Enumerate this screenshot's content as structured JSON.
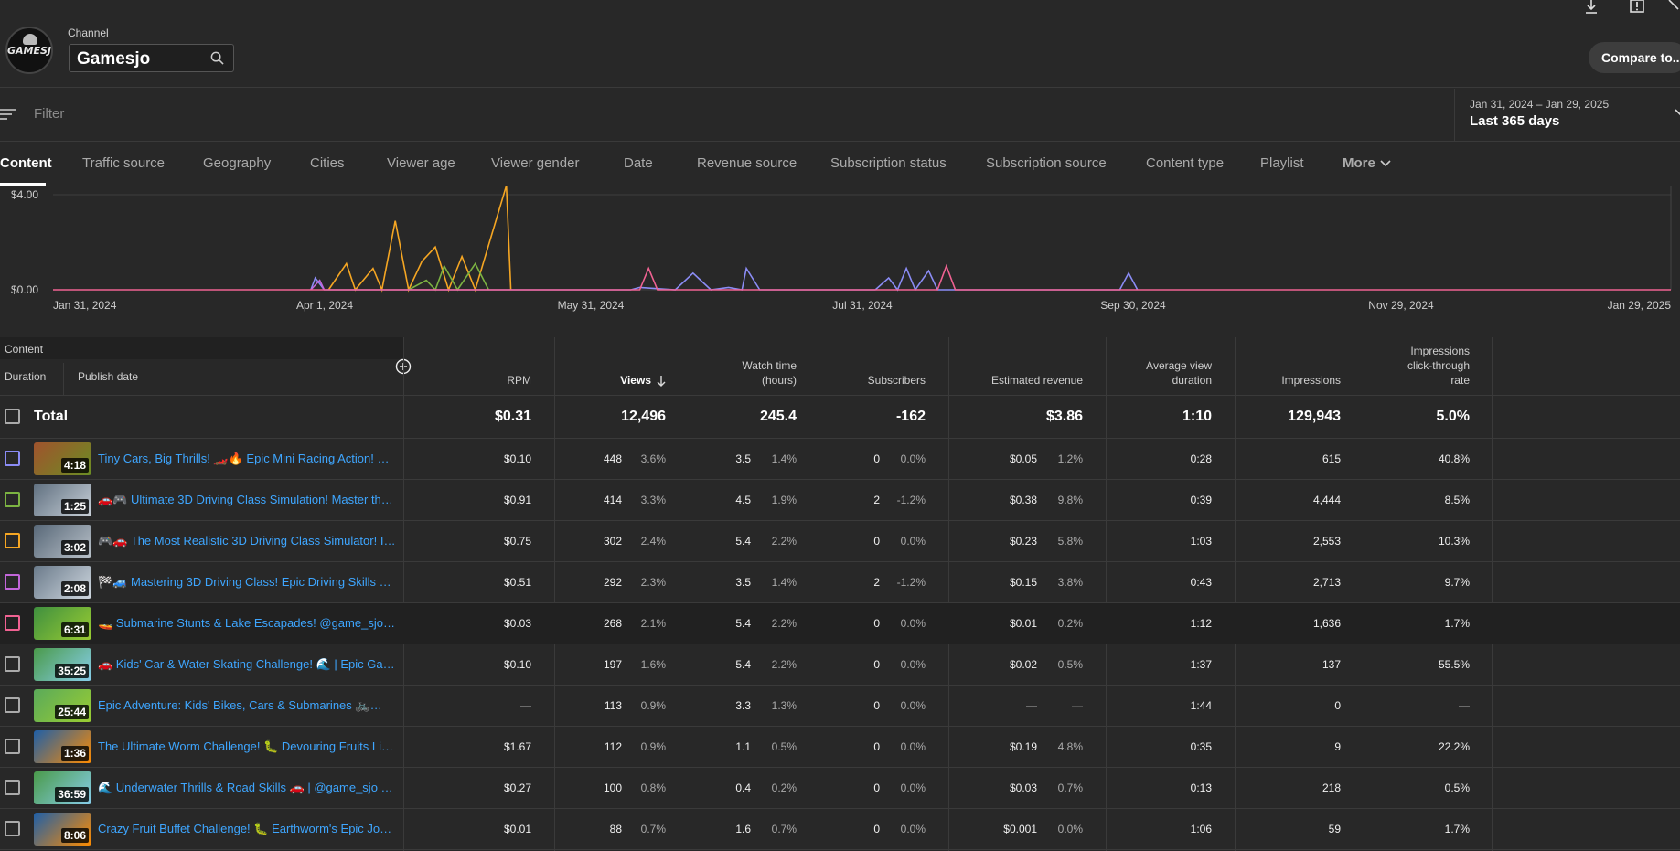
{
  "header": {
    "channel_label": "Channel",
    "channel_value": "Gamesjo",
    "avatar_text": "GAMESJO",
    "compare_button": "Compare to..."
  },
  "filter": {
    "placeholder": "Filter",
    "date_range": "Jan 31, 2024 – Jan 29, 2025",
    "date_preset": "Last 365 days"
  },
  "tabs": [
    {
      "label": "Content",
      "active": true
    },
    {
      "label": "Traffic source"
    },
    {
      "label": "Geography"
    },
    {
      "label": "Cities"
    },
    {
      "label": "Viewer age"
    },
    {
      "label": "Viewer gender"
    },
    {
      "label": "Date"
    },
    {
      "label": "Revenue source"
    },
    {
      "label": "Subscription status"
    },
    {
      "label": "Subscription source"
    },
    {
      "label": "Content type"
    },
    {
      "label": "Playlist"
    },
    {
      "label": "More"
    }
  ],
  "chart_data": {
    "type": "line",
    "y_ticks": [
      "$4.00",
      "$0.00"
    ],
    "x_ticks": [
      "Jan 31, 2024",
      "Apr 1, 2024",
      "May 31, 2024",
      "Jul 31, 2024",
      "Sep 30, 2024",
      "Nov 29, 2024",
      "Jan 29, 2025"
    ],
    "ylim": [
      0,
      4
    ],
    "series": [
      {
        "color": "#f5a623",
        "points": [
          [
            62,
            0
          ],
          [
            66,
            1.1
          ],
          [
            68,
            0
          ],
          [
            72,
            0.9
          ],
          [
            74,
            0
          ],
          [
            77,
            2.9
          ],
          [
            80,
            0
          ],
          [
            83,
            1.2
          ],
          [
            86,
            1.8
          ],
          [
            89,
            0
          ],
          [
            92,
            1.4
          ],
          [
            95,
            0
          ],
          [
            102,
            4.4
          ],
          [
            103,
            0
          ]
        ]
      },
      {
        "color": "#7cb342",
        "points": [
          [
            80,
            0
          ],
          [
            84,
            0.4
          ],
          [
            86,
            0
          ],
          [
            88,
            1.0
          ],
          [
            91,
            0
          ],
          [
            95,
            1.1
          ],
          [
            98,
            0
          ]
        ]
      },
      {
        "color": "#8b8cf5",
        "points": [
          [
            58,
            0
          ],
          [
            59,
            0.5
          ],
          [
            61,
            0
          ],
          [
            130,
            0
          ],
          [
            132,
            0.1
          ],
          [
            140,
            0
          ],
          [
            144,
            0.7
          ],
          [
            148,
            0
          ],
          [
            152,
            0.1
          ],
          [
            155,
            0
          ],
          [
            156,
            0.9
          ],
          [
            159,
            0
          ],
          [
            185,
            0
          ],
          [
            188,
            0.5
          ],
          [
            190,
            0
          ],
          [
            192,
            0.9
          ],
          [
            194,
            0
          ],
          [
            197,
            0.8
          ],
          [
            199,
            0
          ],
          [
            240,
            0
          ],
          [
            242,
            0.7
          ],
          [
            244,
            0
          ]
        ]
      },
      {
        "color": "#c266d9",
        "points": [
          [
            58,
            0
          ],
          [
            60,
            0.4
          ],
          [
            61,
            0
          ]
        ]
      },
      {
        "color": "#f06292",
        "points": [
          [
            0,
            0
          ],
          [
            132,
            0
          ],
          [
            134,
            0.9
          ],
          [
            136,
            0
          ],
          [
            199,
            0
          ],
          [
            201,
            1.0
          ],
          [
            203,
            0
          ],
          [
            364,
            0
          ]
        ]
      }
    ]
  },
  "table": {
    "content_header": "Content",
    "duration_header": "Duration",
    "publish_header": "Publish date",
    "columns": [
      {
        "label": "RPM"
      },
      {
        "label": "Views",
        "sorted": true
      },
      {
        "label": "Watch time\n(hours)"
      },
      {
        "label": "Subscribers"
      },
      {
        "label": "Estimated revenue"
      },
      {
        "label": "Average view\nduration"
      },
      {
        "label": "Impressions"
      },
      {
        "label": "Impressions\nclick-through\nrate"
      }
    ],
    "total": {
      "label": "Total",
      "rpm": "$0.31",
      "views": "12,496",
      "watch": "245.4",
      "subs": "-162",
      "revenue": "$3.86",
      "avd": "1:10",
      "impr": "129,943",
      "ctr": "5.0%"
    },
    "rows": [
      {
        "color": "#8b8cf5",
        "duration": "4:18",
        "title": "Tiny Cars, Big Thrills! 🏎️🔥 Epic Mini Racing Action! @game_sjo",
        "rpm": "$0.10",
        "views": "448",
        "views_pct": "3.6%",
        "watch": "3.5",
        "watch_pct": "1.4%",
        "subs": "0",
        "subs_pct": "0.0%",
        "rev": "$0.05",
        "rev_pct": "1.2%",
        "avd": "0:28",
        "impr": "615",
        "ctr": "40.8%",
        "thumb": [
          "#a0522d",
          "#6b8e23"
        ]
      },
      {
        "color": "#7cb342",
        "duration": "1:25",
        "title": "🚗🎮 Ultimate 3D Driving Class Simulation! Master the Roads",
        "rpm": "$0.91",
        "views": "414",
        "views_pct": "3.3%",
        "watch": "4.5",
        "watch_pct": "1.9%",
        "subs": "2",
        "subs_pct": "-1.2%",
        "rev": "$0.38",
        "rev_pct": "9.8%",
        "avd": "0:39",
        "impr": "4,444",
        "ctr": "8.5%",
        "thumb": [
          "#607080",
          "#c8d0d8"
        ]
      },
      {
        "color": "#f5a623",
        "duration": "3:02",
        "title": "🎮🚗 The Most Realistic 3D Driving Class Simulator! Incredible",
        "rpm": "$0.75",
        "views": "302",
        "views_pct": "2.4%",
        "watch": "5.4",
        "watch_pct": "2.2%",
        "subs": "0",
        "subs_pct": "0.0%",
        "rev": "$0.23",
        "rev_pct": "5.8%",
        "avd": "1:03",
        "impr": "2,553",
        "ctr": "10.3%",
        "thumb": [
          "#586878",
          "#b8c0c8"
        ]
      },
      {
        "color": "#c266d9",
        "duration": "2:08",
        "title": "🏁🚙 Mastering 3D Driving Class! Epic Driving Skills & Challenges",
        "rpm": "$0.51",
        "views": "292",
        "views_pct": "2.3%",
        "watch": "3.5",
        "watch_pct": "1.4%",
        "subs": "2",
        "subs_pct": "-1.2%",
        "rev": "$0.15",
        "rev_pct": "3.8%",
        "avd": "0:43",
        "impr": "2,713",
        "ctr": "9.7%",
        "thumb": [
          "#6a7a8a",
          "#d0d8e0"
        ]
      },
      {
        "color": "#f06292",
        "duration": "6:31",
        "title": "🚤 Submarine Stunts & Lake Escapades! @game_sjo #gaming",
        "rpm": "$0.03",
        "views": "268",
        "views_pct": "2.1%",
        "watch": "5.4",
        "watch_pct": "2.2%",
        "subs": "0",
        "subs_pct": "0.0%",
        "rev": "$0.01",
        "rev_pct": "0.2%",
        "avd": "1:12",
        "impr": "1,636",
        "ctr": "1.7%",
        "thumb": [
          "#3f8f3f",
          "#9acd32"
        ]
      },
      {
        "color": "#aaaaaa",
        "duration": "35:25",
        "title": "🚗 Kids' Car & Water Skating Challenge! 🌊 | Epic Gameplay",
        "rpm": "$0.10",
        "views": "197",
        "views_pct": "1.6%",
        "watch": "5.4",
        "watch_pct": "2.2%",
        "subs": "0",
        "subs_pct": "0.0%",
        "rev": "$0.02",
        "rev_pct": "0.5%",
        "avd": "1:37",
        "impr": "137",
        "ctr": "55.5%",
        "thumb": [
          "#4a9a4a",
          "#87ceeb"
        ]
      },
      {
        "color": "#aaaaaa",
        "duration": "25:44",
        "title": "Epic Adventure: Kids' Bikes, Cars & Submarines 🚲🚗🌊 Fun",
        "rpm": "—",
        "views": "113",
        "views_pct": "0.9%",
        "watch": "3.3",
        "watch_pct": "1.3%",
        "subs": "0",
        "subs_pct": "0.0%",
        "rev": "—",
        "rev_pct": "—",
        "avd": "1:44",
        "impr": "0",
        "ctr": "—",
        "thumb": [
          "#5aaa5a",
          "#9acd32"
        ]
      },
      {
        "color": "#aaaaaa",
        "duration": "1:36",
        "title": "The Ultimate Worm Challenge! 🐛 Devouring Fruits Like Never Before",
        "rpm": "$1.67",
        "views": "112",
        "views_pct": "0.9%",
        "watch": "1.1",
        "watch_pct": "0.5%",
        "subs": "0",
        "subs_pct": "0.0%",
        "rev": "$0.19",
        "rev_pct": "4.8%",
        "avd": "0:35",
        "impr": "9",
        "ctr": "22.2%",
        "thumb": [
          "#1e5fa8",
          "#ff8c00"
        ]
      },
      {
        "color": "#aaaaaa",
        "duration": "36:59",
        "title": "🌊 Underwater Thrills & Road Skills 🚗 | @game_sjo #jtg",
        "rpm": "$0.27",
        "views": "100",
        "views_pct": "0.8%",
        "watch": "0.4",
        "watch_pct": "0.2%",
        "subs": "0",
        "subs_pct": "0.0%",
        "rev": "$0.03",
        "rev_pct": "0.7%",
        "avd": "0:13",
        "impr": "218",
        "ctr": "0.5%",
        "thumb": [
          "#4a9a4a",
          "#87ceeb"
        ]
      },
      {
        "color": "#aaaaaa",
        "duration": "8:06",
        "title": "Crazy Fruit Buffet Challenge! 🐛 Earthworm's Epic Journey",
        "rpm": "$0.01",
        "views": "88",
        "views_pct": "0.7%",
        "watch": "1.6",
        "watch_pct": "0.7%",
        "subs": "0",
        "subs_pct": "0.0%",
        "rev": "$0.001",
        "rev_pct": "0.0%",
        "avd": "1:06",
        "impr": "59",
        "ctr": "1.7%",
        "thumb": [
          "#1e5fa8",
          "#ff8c00"
        ]
      }
    ]
  }
}
